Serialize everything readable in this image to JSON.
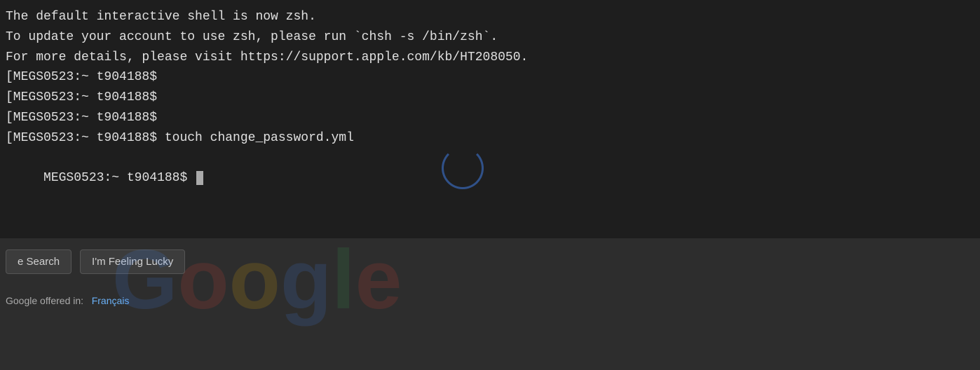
{
  "terminal": {
    "lines": [
      "The default interactive shell is now zsh.",
      "To update your account to use zsh, please run `chsh -s /bin/zsh`.",
      "For more details, please visit https://support.apple.com/kb/HT208050.",
      "[MEGS0523:~ t904188$",
      "[MEGS0523:~ t904188$",
      "[MEGS0523:~ t904188$",
      "[MEGS0523:~ t904188$ touch change_password.yml",
      " MEGS0523:~ t904188$ "
    ],
    "cursor_visible": true
  },
  "google": {
    "search_button_label": "e Search",
    "lucky_button_label": "I'm Feeling Lucky",
    "offered_in_label": "Google offered in:",
    "language_link": "Français"
  }
}
